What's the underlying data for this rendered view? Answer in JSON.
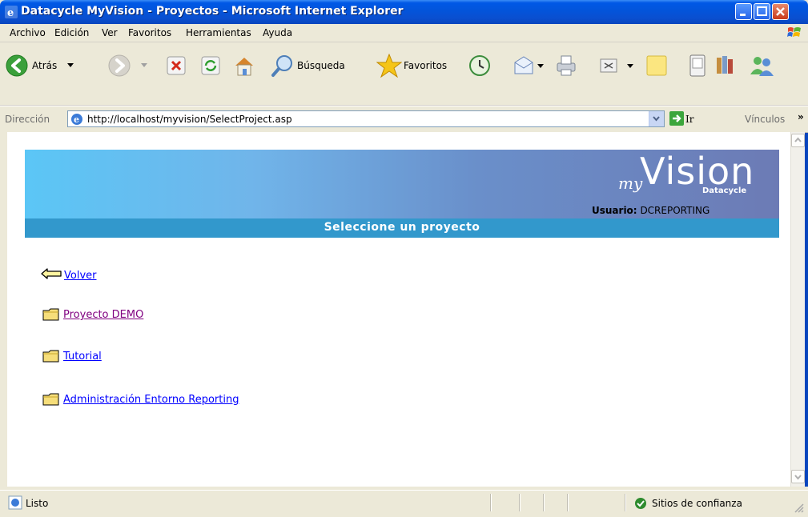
{
  "window": {
    "title": "Datacycle MyVision - Proyectos - Microsoft Internet Explorer"
  },
  "menu": [
    "Archivo",
    "Edición",
    "Ver",
    "Favoritos",
    "Herramientas",
    "Ayuda"
  ],
  "toolbar": {
    "back_label": "Atrás",
    "search_label": "Búsqueda",
    "favorites_label": "Favoritos"
  },
  "address": {
    "label": "Dirección",
    "url": "http://localhost/myvision/SelectProject.asp",
    "go_label": "Ir",
    "links_label": "Vínculos"
  },
  "page": {
    "logo": {
      "prefix": "my",
      "name": "Vision",
      "brand": "Datacycle"
    },
    "user_label": "Usuario:",
    "user_name": "DCREPORTING",
    "subtitle": "Seleccione un proyecto",
    "back_link": "Volver",
    "projects": [
      {
        "label": "Proyecto DEMO",
        "visited": true
      },
      {
        "label": "Tutorial",
        "visited": false
      },
      {
        "label": "Administración Entorno Reporting",
        "visited": false
      }
    ]
  },
  "status": {
    "text": "Listo",
    "zone": "Sitios de confianza"
  },
  "colors": {
    "titlebar": "#0058E6",
    "banner_start": "#5BC6F6",
    "banner_end": "#6C7BB5",
    "subbar": "#3298CC",
    "link": "#0000FF",
    "visited": "#800080"
  }
}
